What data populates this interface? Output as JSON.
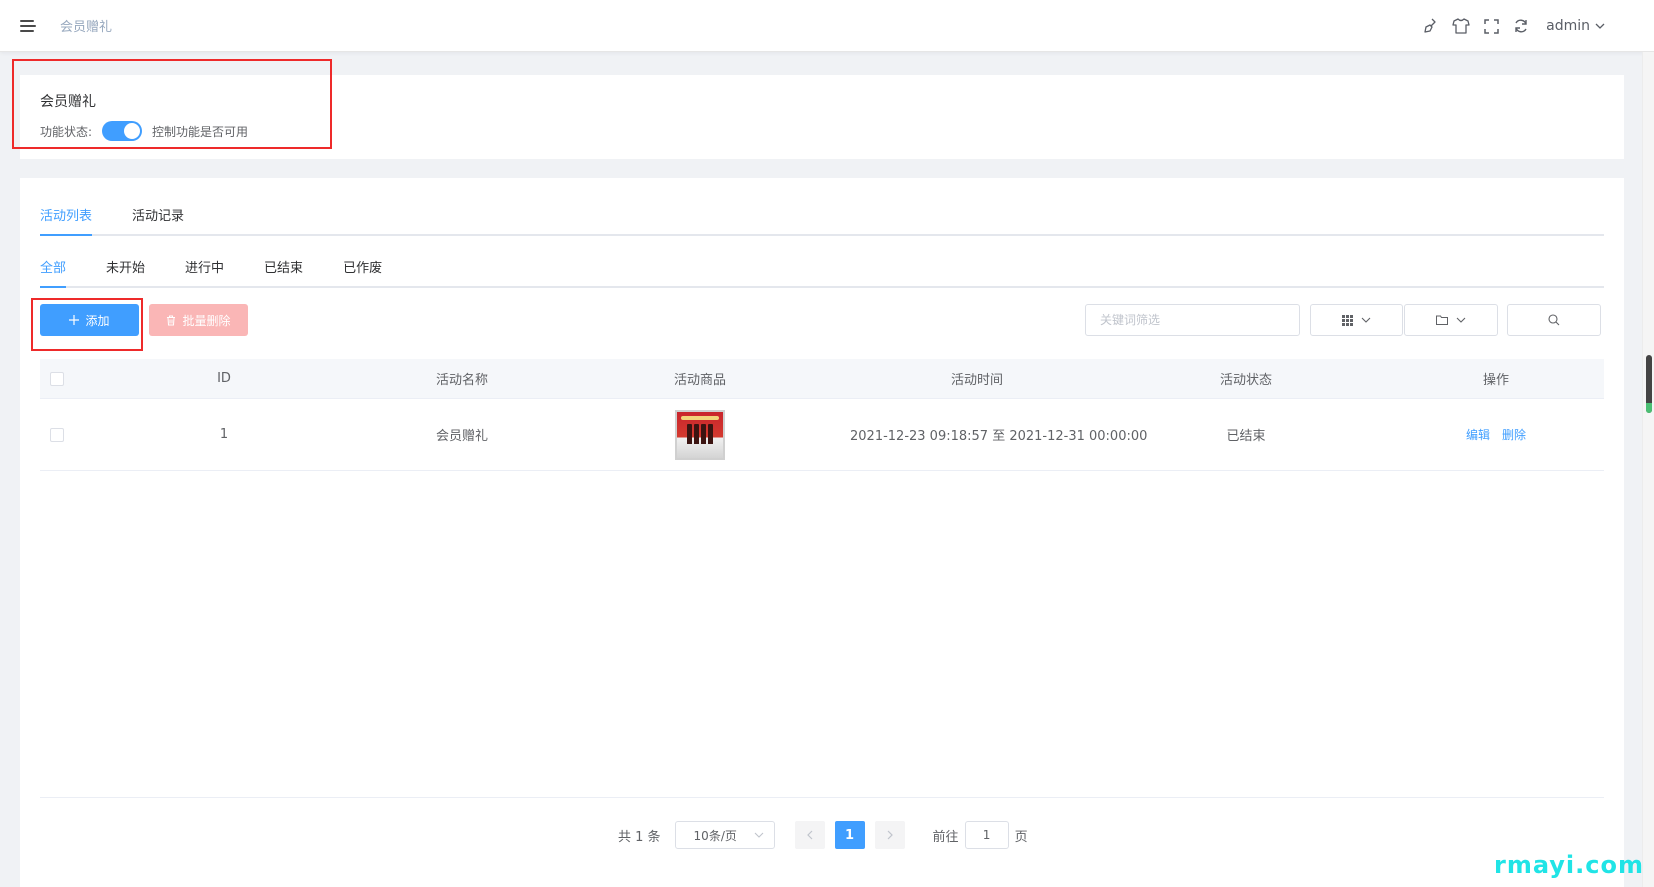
{
  "header": {
    "breadcrumb": "会员赠礼",
    "user": "admin",
    "icons": [
      "broom-icon",
      "shirt-icon",
      "fullscreen-icon",
      "refresh-icon"
    ]
  },
  "feature": {
    "title": "会员赠礼",
    "status_label": "功能状态:",
    "switch_on": true,
    "description": "控制功能是否可用"
  },
  "tabs": [
    {
      "label": "活动列表",
      "active": true
    },
    {
      "label": "活动记录",
      "active": false
    }
  ],
  "subtabs": [
    {
      "label": "全部",
      "active": true
    },
    {
      "label": "未开始",
      "active": false
    },
    {
      "label": "进行中",
      "active": false
    },
    {
      "label": "已结束",
      "active": false
    },
    {
      "label": "已作废",
      "active": false
    }
  ],
  "toolbar": {
    "add_label": "添加",
    "bulk_delete_label": "批量删除",
    "search_placeholder": "关键词筛选"
  },
  "table": {
    "columns": [
      "ID",
      "活动名称",
      "活动商品",
      "活动时间",
      "活动状态",
      "操作"
    ],
    "rows": [
      {
        "id": "1",
        "name": "会员赠礼",
        "time": "2021-12-23 09:18:57 至 2021-12-31 00:00:00",
        "status": "已结束",
        "edit": "编辑",
        "delete": "删除"
      }
    ]
  },
  "pagination": {
    "total": "共 1 条",
    "page_size": "10条/页",
    "current": "1",
    "goto_label": "前往",
    "goto_value": "1",
    "page_suffix": "页"
  },
  "watermark": "rmayi.com",
  "colors": {
    "accent": "#409eff",
    "danger_light": "#fab6b6",
    "highlight_frame": "#ee2a2a",
    "watermark": "#20e4e6"
  }
}
